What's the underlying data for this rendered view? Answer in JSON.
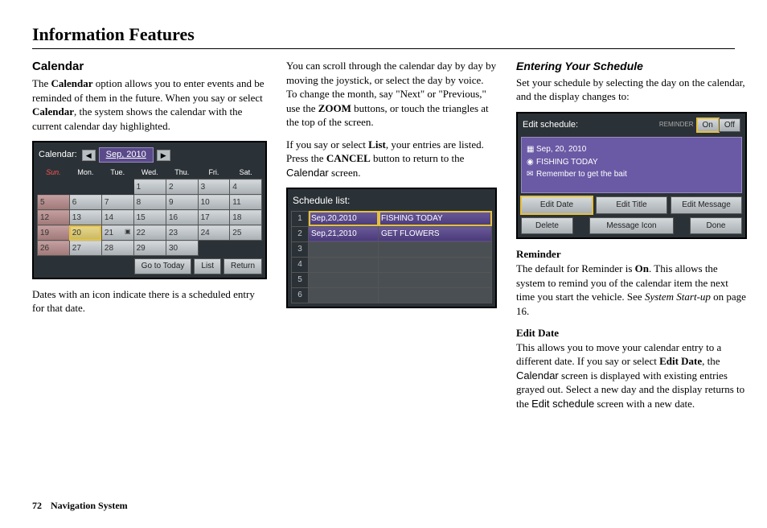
{
  "title": "Information Features",
  "col1": {
    "heading": "Calendar",
    "p1a": "The ",
    "p1b": "Calendar",
    "p1c": " option allows you to enter events and be reminded of them in the future. When you say or select ",
    "p1d": "Calendar",
    "p1e": ", the system shows the calendar with the current calendar day highlighted.",
    "p2": "Dates with an icon indicate there is a scheduled entry for that date."
  },
  "calendar": {
    "label": "Calendar:",
    "month": "Sep, 2010",
    "dow": [
      "Sun.",
      "Mon.",
      "Tue.",
      "Wed.",
      "Thu.",
      "Fri.",
      "Sat."
    ],
    "weeks": [
      [
        "",
        "",
        "",
        "1",
        "2",
        "3",
        "4"
      ],
      [
        "5",
        "6",
        "7",
        "8",
        "9",
        "10",
        "11"
      ],
      [
        "12",
        "13",
        "14",
        "15",
        "16",
        "17",
        "18"
      ],
      [
        "19",
        "20",
        "21",
        "22",
        "23",
        "24",
        "25"
      ],
      [
        "26",
        "27",
        "28",
        "29",
        "30",
        "",
        ""
      ]
    ],
    "today_r": 3,
    "today_c": 1,
    "icon_r": 3,
    "icon_c": 2,
    "buttons": {
      "goto": "Go to Today",
      "list": "List",
      "return": "Return"
    }
  },
  "col2": {
    "p1a": "You can scroll through the calendar day by day by moving the joystick, or select the day by voice. To change the month, say \"Next\" or \"Previous,\" use the ",
    "p1b": "ZOOM",
    "p1c": " buttons, or touch the triangles at the top of the screen.",
    "p2a": "If you say or select ",
    "p2b": "List",
    "p2c": ", your entries are listed. Press the ",
    "p2d": "CANCEL",
    "p2e": " button to return to the ",
    "p2f": "Calendar",
    "p2g": " screen."
  },
  "schedule_list": {
    "title": "Schedule list:",
    "rows": [
      {
        "n": "1",
        "date": "Sep,20,2010",
        "text": "FISHING TODAY",
        "sel": true
      },
      {
        "n": "2",
        "date": "Sep,21,2010",
        "text": "GET FLOWERS",
        "sel": false
      },
      {
        "n": "3",
        "date": "",
        "text": "",
        "sel": false
      },
      {
        "n": "4",
        "date": "",
        "text": "",
        "sel": false
      },
      {
        "n": "5",
        "date": "",
        "text": "",
        "sel": false
      },
      {
        "n": "6",
        "date": "",
        "text": "",
        "sel": false
      }
    ]
  },
  "col3": {
    "heading": "Entering Your Schedule",
    "p1": "Set your schedule by selecting the day on the calendar, and the display changes to:",
    "reminder_h": "Reminder",
    "reminder_a": "The default for Reminder is ",
    "reminder_b": "On",
    "reminder_c": ". This allows the system to remind you of the calendar item the next time you start the vehicle. See ",
    "reminder_d": "System Start-up",
    "reminder_e": " on page 16.",
    "editdate_h": "Edit Date",
    "editdate_a": "This allows you to move your calendar entry to a different date. If you say or select ",
    "editdate_b": "Edit Date",
    "editdate_c": ", the ",
    "editdate_d": "Calendar",
    "editdate_e": " screen is displayed with existing entries grayed out. Select a new day and the display returns to the ",
    "editdate_f": "Edit schedule",
    "editdate_g": " screen with a new date."
  },
  "edit_schedule": {
    "title": "Edit schedule:",
    "reminder_label": "REMINDER",
    "on": "On",
    "off": "Off",
    "lines": {
      "date": "Sep, 20, 2010",
      "title": "FISHING TODAY",
      "msg": "Remember to get the bait"
    },
    "buttons": {
      "edit_date": "Edit Date",
      "edit_title": "Edit Title",
      "edit_message": "Edit Message",
      "delete": "Delete",
      "message_icon": "Message Icon",
      "done": "Done"
    }
  },
  "footer": {
    "page": "72",
    "section": "Navigation System"
  }
}
